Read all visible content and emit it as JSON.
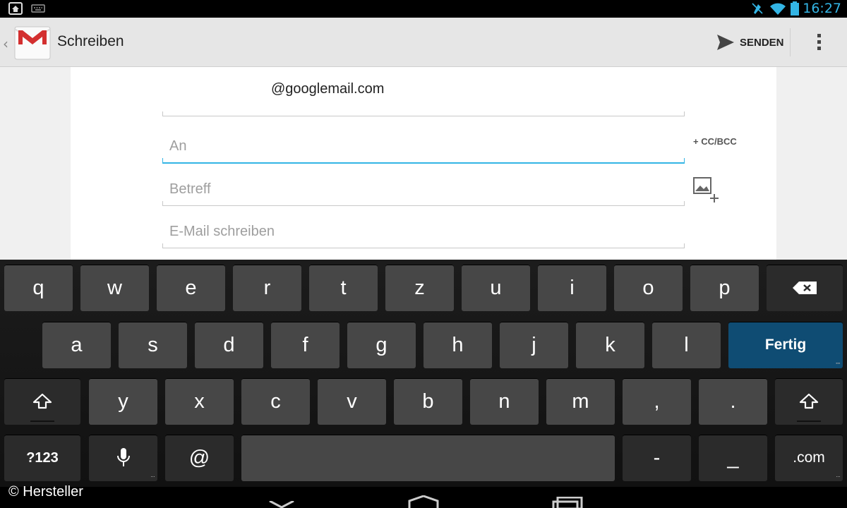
{
  "status_bar": {
    "time": "16:27",
    "icons": [
      "home-icon",
      "keyboard-icon",
      "mute-icon",
      "wifi-icon",
      "battery-icon"
    ]
  },
  "action_bar": {
    "title": "Schreiben",
    "send_label": "SENDEN",
    "icons": [
      "gmail-logo-icon",
      "send-icon",
      "overflow-menu-icon"
    ]
  },
  "compose": {
    "from": "@googlemail.com",
    "to_placeholder": "An",
    "cc_bcc_label": "+ CC/BCC",
    "subject_placeholder": "Betreff",
    "body_placeholder": "E-Mail schreiben"
  },
  "keyboard": {
    "row1": [
      "q",
      "w",
      "e",
      "r",
      "t",
      "z",
      "u",
      "i",
      "o",
      "p"
    ],
    "row2": [
      "a",
      "s",
      "d",
      "f",
      "g",
      "h",
      "j",
      "k",
      "l"
    ],
    "done_label": "Fertig",
    "row3": [
      "y",
      "x",
      "c",
      "v",
      "b",
      "n",
      "m",
      ",",
      "."
    ],
    "symbols_label": "?123",
    "at_label": "@",
    "dash_label": "-",
    "underscore_label": "_",
    "dotcom_label": ".com",
    "colors": {
      "key": "#474747",
      "dark_key": "#2b2b2b",
      "done_key": "#0f4c73",
      "accent": "#33b5e5"
    }
  },
  "footer": {
    "copyright": "© Hersteller"
  }
}
